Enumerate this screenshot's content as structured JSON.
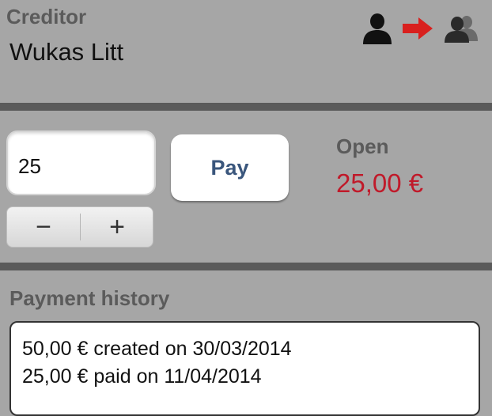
{
  "creditor": {
    "label": "Creditor",
    "name": "Wukas Litt",
    "icons": [
      "person-icon",
      "arrow-right-icon",
      "group-icon"
    ],
    "arrow_color": "#d9201e"
  },
  "payment": {
    "amount_value": "25",
    "pay_label": "Pay",
    "stepper": {
      "minus": "−",
      "plus": "+"
    }
  },
  "open": {
    "label": "Open",
    "amount": "25,00 €",
    "amount_color": "#c01a2a"
  },
  "history": {
    "label": "Payment history",
    "entries": [
      "50,00 € created on 30/03/2014",
      "25,00 € paid on 11/04/2014"
    ]
  }
}
